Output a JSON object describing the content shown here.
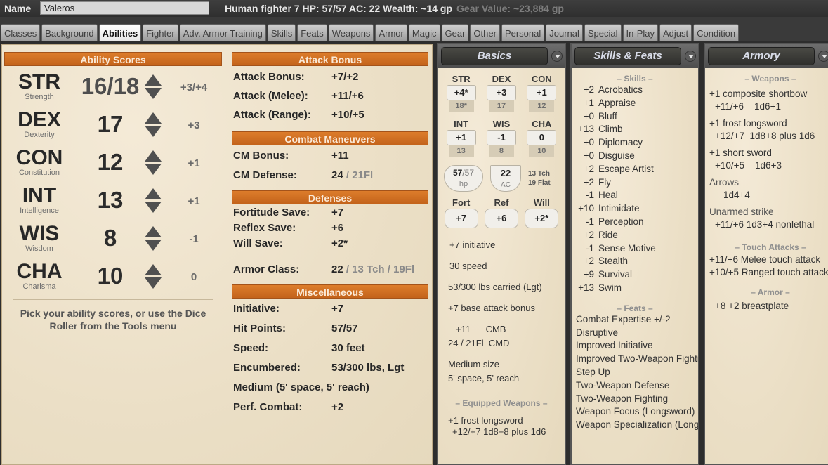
{
  "header": {
    "name_label": "Name",
    "name_value": "Valeros",
    "summary": "Human fighter 7  HP: 57/57  AC: 22  Wealth: ~14 gp",
    "gear_value": "Gear Value: ~23,884 gp"
  },
  "tabs": [
    {
      "label": "Classes",
      "active": false
    },
    {
      "label": "Background",
      "active": false
    },
    {
      "label": "Abilities",
      "active": true
    },
    {
      "label": "Fighter",
      "active": false
    },
    {
      "label": "Adv. Armor Training",
      "active": false
    },
    {
      "label": "Skills",
      "active": false
    },
    {
      "label": "Feats",
      "active": false
    },
    {
      "label": "Weapons",
      "active": false
    },
    {
      "label": "Armor",
      "active": false
    },
    {
      "label": "Magic",
      "active": false
    },
    {
      "label": "Gear",
      "active": false
    },
    {
      "label": "Other",
      "active": false
    },
    {
      "label": "Personal",
      "active": false
    },
    {
      "label": "Journal",
      "active": false
    },
    {
      "label": "Special",
      "active": false
    },
    {
      "label": "In-Play",
      "active": false
    },
    {
      "label": "Adjust",
      "active": false
    },
    {
      "label": "Condition",
      "active": false
    }
  ],
  "abilities": {
    "title": "Ability Scores",
    "rows": [
      {
        "abbr": "STR",
        "full": "Strength",
        "score": "16/18",
        "mod": "+3/+4"
      },
      {
        "abbr": "DEX",
        "full": "Dexterity",
        "score": "17",
        "mod": "+3"
      },
      {
        "abbr": "CON",
        "full": "Constitution",
        "score": "12",
        "mod": "+1"
      },
      {
        "abbr": "INT",
        "full": "Intelligence",
        "score": "13",
        "mod": "+1"
      },
      {
        "abbr": "WIS",
        "full": "Wisdom",
        "score": "8",
        "mod": "-1"
      },
      {
        "abbr": "CHA",
        "full": "Charisma",
        "score": "10",
        "mod": "0"
      }
    ],
    "hint": "Pick your ability scores, or use the Dice Roller from the Tools menu"
  },
  "attack": {
    "title": "Attack Bonus",
    "rows": [
      {
        "k": "Attack Bonus:",
        "v": "+7/+2"
      },
      {
        "k": "Attack (Melee):",
        "v": "+11/+6"
      },
      {
        "k": "Attack (Range):",
        "v": "+10/+5"
      }
    ]
  },
  "combat_maneuvers": {
    "title": "Combat Maneuvers",
    "bonus_label": "CM Bonus:",
    "bonus": "+11",
    "defense_label": "CM Defense:",
    "defense": "24",
    "defense_flat": " / 21Fl"
  },
  "defenses": {
    "title": "Defenses",
    "rows": [
      {
        "k": "Fortitude Save:",
        "v": "+7"
      },
      {
        "k": "Reflex Save:",
        "v": "+6"
      },
      {
        "k": "Will Save:",
        "v": "+2*"
      }
    ],
    "ac_label": "Armor Class:",
    "ac": "22",
    "ac_extra": " / 13 Tch / 19Fl"
  },
  "misc": {
    "title": "Miscellaneous",
    "rows": [
      {
        "k": "Initiative:",
        "v": "+7"
      },
      {
        "k": "Hit Points:",
        "v": "57/57"
      },
      {
        "k": "Speed:",
        "v": "30 feet"
      },
      {
        "k": "Encumbered:",
        "v": "53/300 lbs, Lgt"
      }
    ],
    "size_line": "Medium (5' space, 5' reach)",
    "perf_label": "Perf. Combat:",
    "perf": "+2"
  },
  "basics": {
    "title": "Basics",
    "stats": [
      {
        "abbr": "STR",
        "mod": "+4*",
        "score": "18*"
      },
      {
        "abbr": "DEX",
        "mod": "+3",
        "score": "17"
      },
      {
        "abbr": "CON",
        "mod": "+1",
        "score": "12"
      },
      {
        "abbr": "INT",
        "mod": "+1",
        "score": "13"
      },
      {
        "abbr": "WIS",
        "mod": "-1",
        "score": "8"
      },
      {
        "abbr": "CHA",
        "mod": "0",
        "score": "10"
      }
    ],
    "hp_cur": "57",
    "hp_max": "/57",
    "hp_label": "hp",
    "ac": "22",
    "ac_label": "AC",
    "ac_touch": "13 Tch",
    "ac_flat": "19 Flat",
    "saves": [
      {
        "label": "Fort",
        "value": "+7"
      },
      {
        "label": "Ref",
        "value": "+6"
      },
      {
        "label": "Will",
        "value": "+2*"
      }
    ],
    "initiative": "+7  initiative",
    "speed": "30  speed",
    "carried": "53/300 lbs carried (Lgt)",
    "bab": "+7 base attack bonus",
    "cmb": "   +11      CMB",
    "cmd": "24 / 21Fl  CMD",
    "size": "Medium size",
    "space": "5' space, 5' reach",
    "equipped_hdr": "– Equipped Weapons –",
    "equipped": [
      {
        "name": "+1 frost longsword",
        "stats": "+12/+7  1d8+8 plus 1d6"
      }
    ]
  },
  "skills_feats": {
    "title": "Skills & Feats",
    "skills_hdr": "– Skills –",
    "skills": [
      {
        "v": "+2",
        "n": "Acrobatics"
      },
      {
        "v": "+1",
        "n": "Appraise"
      },
      {
        "v": "+0",
        "n": "Bluff"
      },
      {
        "v": "+13",
        "n": "Climb"
      },
      {
        "v": "+0",
        "n": "Diplomacy"
      },
      {
        "v": "+0",
        "n": "Disguise"
      },
      {
        "v": "+2",
        "n": "Escape Artist"
      },
      {
        "v": "+2",
        "n": "Fly"
      },
      {
        "v": "-1",
        "n": "Heal"
      },
      {
        "v": "+10",
        "n": "Intimidate"
      },
      {
        "v": "-1",
        "n": "Perception"
      },
      {
        "v": "+2",
        "n": "Ride"
      },
      {
        "v": "-1",
        "n": "Sense Motive"
      },
      {
        "v": "+2",
        "n": "Stealth"
      },
      {
        "v": "+9",
        "n": "Survival"
      },
      {
        "v": "+13",
        "n": "Swim"
      }
    ],
    "feats_hdr": "– Feats –",
    "feats": [
      "Combat Expertise +/-2",
      "Disruptive",
      "Improved Initiative",
      "Improved Two-Weapon Fighting",
      "Step Up",
      "Two-Weapon Defense",
      "Two-Weapon Fighting",
      "Weapon Focus (Longsword)",
      "Weapon Specialization (Longsword)"
    ]
  },
  "armory": {
    "title": "Armory",
    "weapons_hdr": "– Weapons –",
    "weapons": [
      {
        "name": "+1 composite shortbow",
        "stats": "+11/+6    1d6+1"
      },
      {
        "name": "+1 frost longsword",
        "stats": "+12/+7  1d8+8 plus 1d6"
      },
      {
        "name": "+1 short sword",
        "stats": "+10/+5    1d6+3"
      }
    ],
    "arrows_name": "Arrows",
    "arrows_stats": "1d4+4",
    "unarmed_name": "Unarmed strike",
    "unarmed_stats": "+11/+6  1d3+4 nonlethal",
    "touch_hdr": "– Touch Attacks –",
    "touch": [
      "+11/+6  Melee touch attack",
      "+10/+5  Ranged touch attack"
    ],
    "armor_hdr": "– Armor –",
    "armor": [
      "+8  +2 breastplate"
    ]
  }
}
